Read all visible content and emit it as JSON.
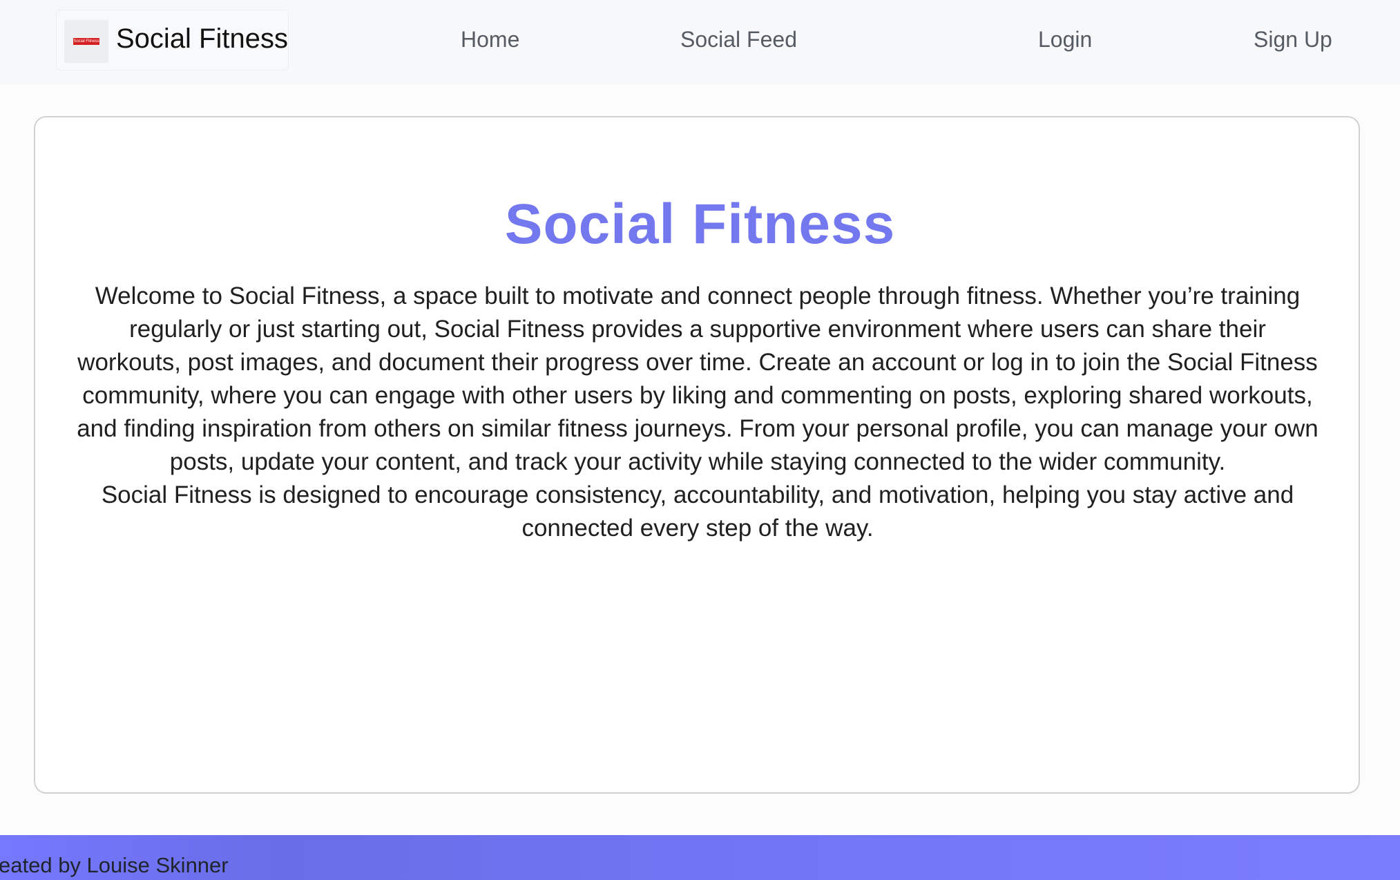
{
  "colors": {
    "accent": "#7478EF",
    "footer": "#7678FF",
    "nav_text": "#555B63"
  },
  "navbar": {
    "brand_text": "Social Fitness",
    "logo_text": "Social Fitness",
    "logo_icon": "social-fitness-logo",
    "links": [
      {
        "label": "Home"
      },
      {
        "label": "Social Feed"
      },
      {
        "label": "Login"
      },
      {
        "label": "Sign Up"
      }
    ]
  },
  "main": {
    "title": "Social Fitness",
    "paragraph_1": "Welcome to Social Fitness, a space built to motivate and connect people through fitness. Whether you’re training regularly or just starting out, Social Fitness provides a supportive environment where users can share their workouts, post images, and document their progress over time. Create an account or log in to join the Social Fitness community, where you can engage with other users by liking and commenting on posts, exploring shared workouts, and finding inspiration from others on similar fitness journeys. From your personal profile, you can manage your own posts, update your content, and track your activity while staying connected to the wider community.",
    "paragraph_2": "Social Fitness is designed to encourage consistency, accountability, and motivation, helping you stay active and connected every step of the way."
  },
  "footer": {
    "text": "eated by Louise Skinner"
  }
}
